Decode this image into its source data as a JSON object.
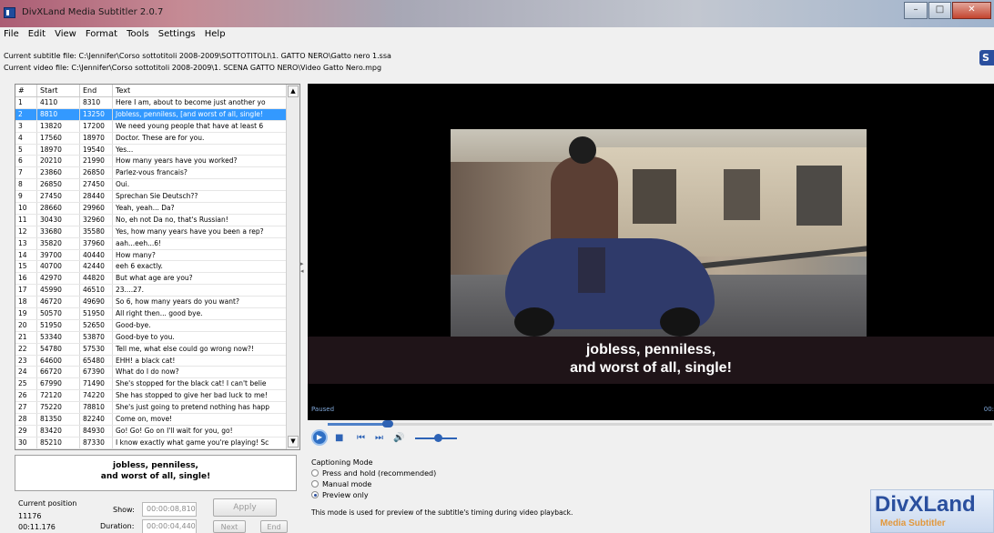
{
  "window": {
    "title": "DivXLand Media Subtitler 2.0.7"
  },
  "menu": [
    "File",
    "Edit",
    "View",
    "Format",
    "Tools",
    "Settings",
    "Help"
  ],
  "files": {
    "subtitle": "Current subtitle file: C:\\Jennifer\\Corso sottotitoli 2008-2009\\SOTTOTITOLI\\1. GATTO NERO\\Gatto nero 1.ssa",
    "video": "Current video file: C:\\Jennifer\\Corso sottotitoli 2008-2009\\1. SCENA GATTO NERO\\Video Gatto Nero.mpg"
  },
  "table": {
    "columns": [
      "#",
      "Start",
      "End",
      "Text"
    ],
    "selected_index": 1,
    "rows": [
      [
        "1",
        "4110",
        "8310",
        "Here I am, about to become just another yo"
      ],
      [
        "2",
        "8810",
        "13250",
        "Jobless, penniless, [and worst of all, single!"
      ],
      [
        "3",
        "13820",
        "17200",
        "We need young people that have at least 6"
      ],
      [
        "4",
        "17560",
        "18970",
        "Doctor. These are for you."
      ],
      [
        "5",
        "18970",
        "19540",
        "Yes..."
      ],
      [
        "6",
        "20210",
        "21990",
        " How many years have you worked?"
      ],
      [
        "7",
        "23860",
        "26850",
        "Parlez-vous francais?"
      ],
      [
        "8",
        "26850",
        "27450",
        "Oui."
      ],
      [
        "9",
        "27450",
        "28440",
        "Sprechan Sie Deutsch??"
      ],
      [
        "10",
        "28660",
        "29960",
        "Yeah, yeah... Da?"
      ],
      [
        "11",
        "30430",
        "32960",
        "No, eh not Da no, that's Russian!"
      ],
      [
        "12",
        "33680",
        "35580",
        "Yes, how many years have you been a rep?"
      ],
      [
        "13",
        "35820",
        "37960",
        "aah...eeh...6!"
      ],
      [
        "14",
        "39700",
        "40440",
        "How many?"
      ],
      [
        "15",
        "40700",
        "42440",
        "eeh 6 exactly."
      ],
      [
        "16",
        "42970",
        "44820",
        "But what age are you?"
      ],
      [
        "17",
        "45990",
        "46510",
        "23....27."
      ],
      [
        "18",
        "46720",
        "49690",
        " So 6, how many years do you want?"
      ],
      [
        "19",
        "50570",
        "51950",
        "All right then... good bye."
      ],
      [
        "20",
        "51950",
        "52650",
        "Good-bye."
      ],
      [
        "21",
        "53340",
        "53870",
        "Good-bye to you."
      ],
      [
        "22",
        "54780",
        "57530",
        "Tell me, what else could go wrong now?!"
      ],
      [
        "23",
        "64600",
        "65480",
        "EHH! a black cat!"
      ],
      [
        "24",
        "66720",
        "67390",
        "What do I do now?"
      ],
      [
        "25",
        "67990",
        "71490",
        "She's stopped for the black cat!  I can't belie"
      ],
      [
        "26",
        "72120",
        "74220",
        "She has stopped to give her bad luck to me!"
      ],
      [
        "27",
        "75220",
        "78810",
        "She's just going to pretend nothing has happ"
      ],
      [
        "28",
        "81350",
        "82240",
        "Come on, move!"
      ],
      [
        "29",
        "83420",
        "84930",
        "Go! Go! Go on I'll wait for you, go!"
      ],
      [
        "30",
        "85210",
        "87330",
        "I know exactly what game you're playing! Sc"
      ]
    ]
  },
  "video": {
    "subtitle_line1": "jobless, penniless,",
    "subtitle_line2": "and worst of all, single!",
    "status": "Paused",
    "time_partial": "00:",
    "seek_fraction": 0.09,
    "volume_fraction": 0.55
  },
  "preview": {
    "line1": "jobless, penniless,",
    "line2": "and worst of all, single!"
  },
  "position": {
    "label": "Current position",
    "ms": "11176",
    "time": "00:11.176",
    "show_label": "Show:",
    "show_value": "00:00:08,810",
    "duration_label": "Duration:",
    "duration_value": "00:00:04,440",
    "apply_label": "Apply",
    "next_label": "Next",
    "end_label": "End"
  },
  "captioning": {
    "title": "Captioning Mode",
    "options": [
      "Press and hold (recommended)",
      "Manual mode",
      "Preview only"
    ],
    "selected": 2,
    "note": "This mode is used for preview of the subtitle's timing during video playback."
  },
  "logo": {
    "main": "DivXLand",
    "sub": "Media Subtitler"
  },
  "colors": {
    "selection": "#3399ff",
    "brand_blue": "#2a4f9e",
    "brand_orange": "#e2983c",
    "video_bg": "#000000"
  }
}
